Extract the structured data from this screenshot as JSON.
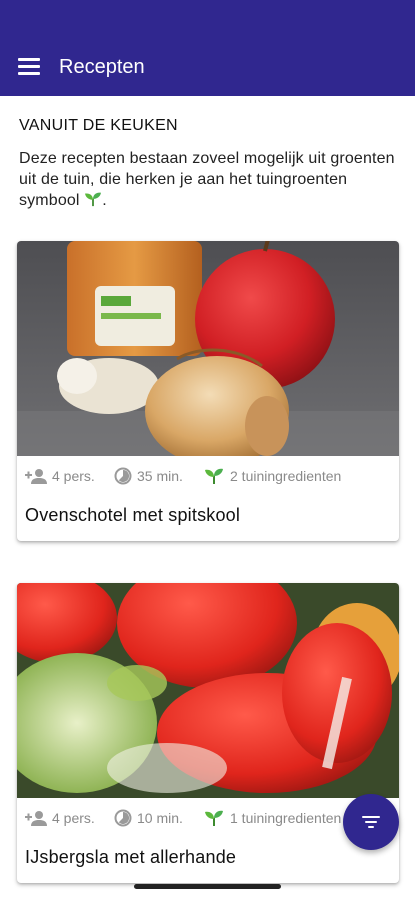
{
  "app_bar": {
    "title": "Recepten",
    "menu_icon": "hamburger-menu-icon",
    "color": "#30278f"
  },
  "section": {
    "heading": "VANUIT DE KEUKEN",
    "intro": "Deze recepten bestaan zoveel mogelijk uit groenten uit de tuin, die herken je aan het tuingroenten symbool"
  },
  "recipes": [
    {
      "title": "Ovenschotel met spitskool",
      "persons": "4 pers.",
      "time": "35 min.",
      "garden_ingredients": "2 tuiningredienten",
      "image": "jar, apple, onion and garlic on dark stone"
    },
    {
      "title": "IJsbergsla met allerhande",
      "persons": "4 pers.",
      "time": "10 min.",
      "garden_ingredients": "1 tuiningredienten",
      "image": "tomato and lettuce salad close-up"
    }
  ],
  "fab": {
    "icon": "filter-icon"
  },
  "colors": {
    "primary": "#30278f",
    "sprout_green": "#4caf50",
    "meta_grey": "#8a8a8a"
  }
}
